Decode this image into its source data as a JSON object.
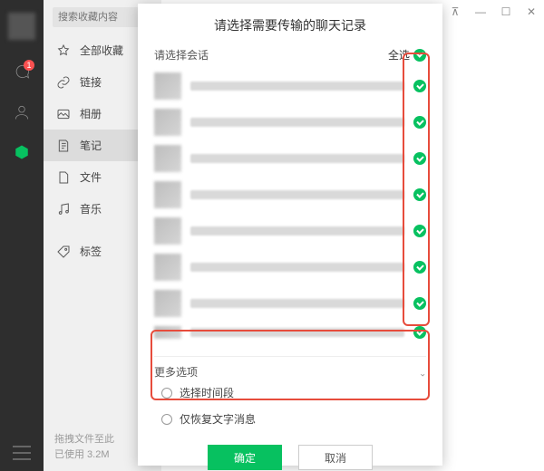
{
  "window": {
    "pin_icon": "⊼",
    "min_icon": "—",
    "max_icon": "☐",
    "close_icon": "✕"
  },
  "rail": {
    "badge": "1"
  },
  "sidebar": {
    "search_placeholder": "搜索收藏内容",
    "items": [
      {
        "label": "全部收藏",
        "icon": "star"
      },
      {
        "label": "链接",
        "icon": "link"
      },
      {
        "label": "相册",
        "icon": "photo"
      },
      {
        "label": "笔记",
        "icon": "note"
      },
      {
        "label": "文件",
        "icon": "file"
      },
      {
        "label": "音乐",
        "icon": "music"
      },
      {
        "label": "标签",
        "icon": "tag"
      }
    ],
    "footer_line1": "拖拽文件至此",
    "footer_line2": "已使用 3.2M"
  },
  "modal": {
    "title": "请选择需要传输的聊天记录",
    "select_conversation_label": "请选择会话",
    "select_all_label": "全选",
    "chats": [
      {
        "selected": true
      },
      {
        "selected": true
      },
      {
        "selected": true
      },
      {
        "selected": true
      },
      {
        "selected": true
      },
      {
        "selected": true
      },
      {
        "selected": true
      },
      {
        "selected": true
      }
    ],
    "more_options_label": "更多选项",
    "option_time_range": "选择时间段",
    "option_text_only": "仅恢复文字消息",
    "confirm_label": "确定",
    "cancel_label": "取消"
  }
}
